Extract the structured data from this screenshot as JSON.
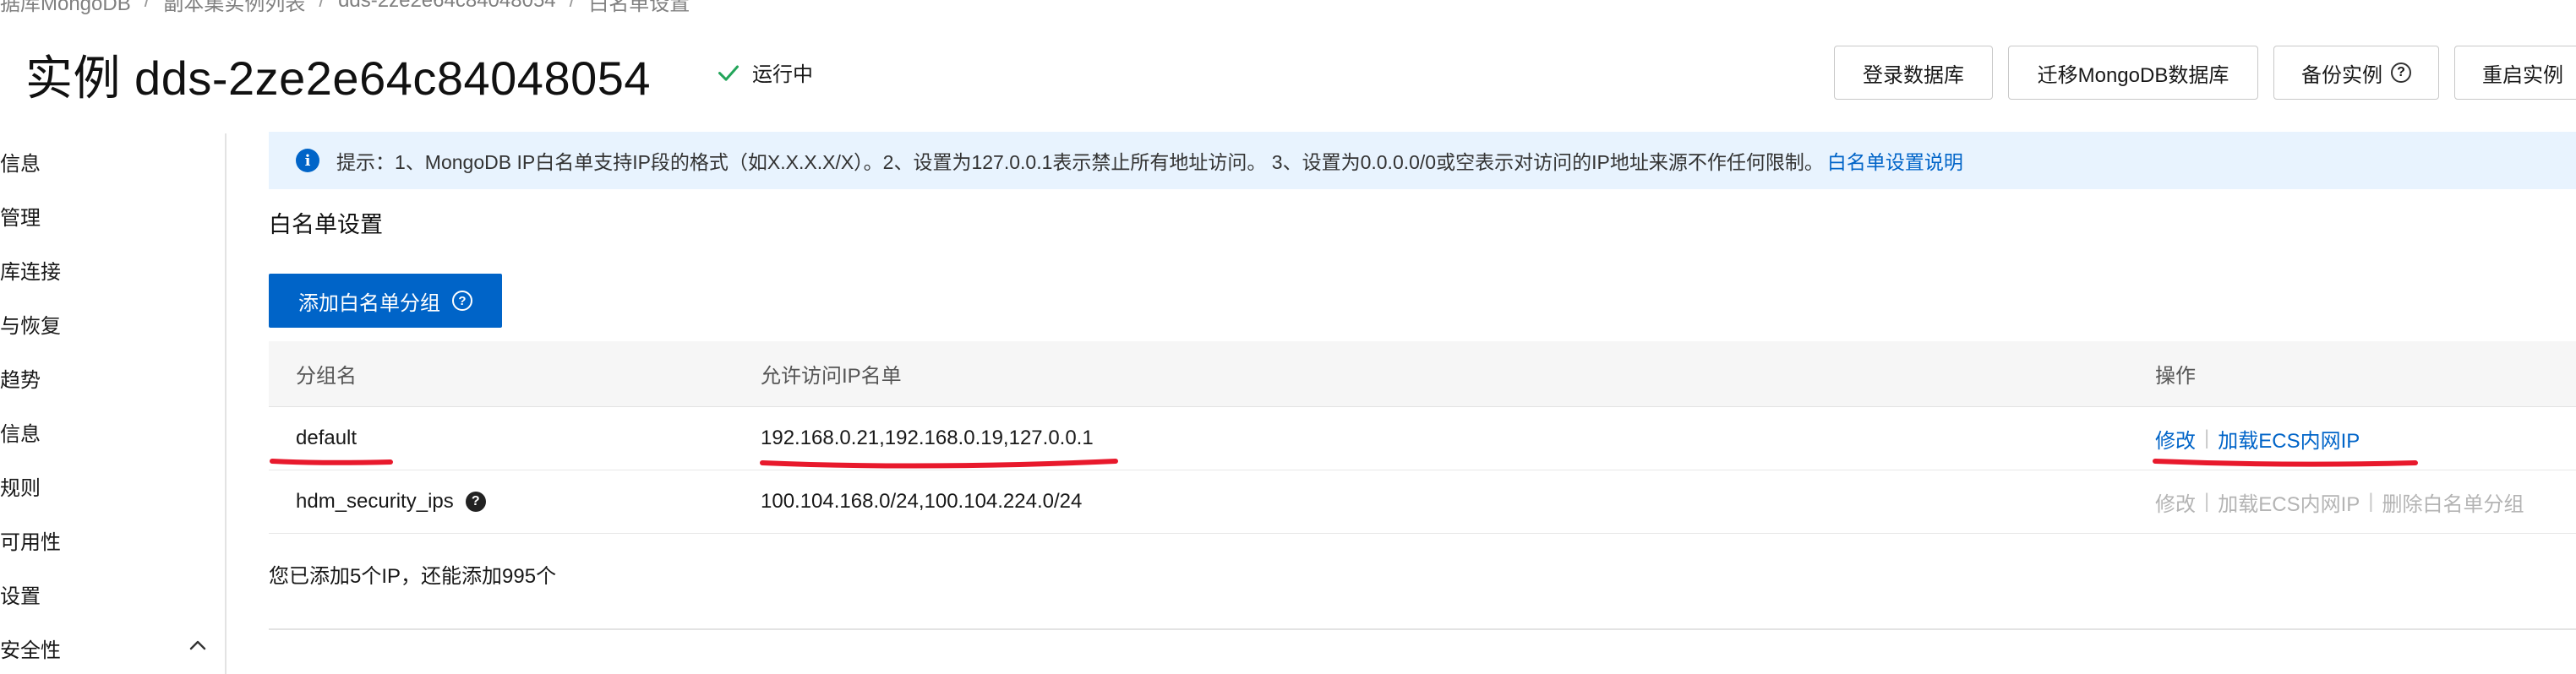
{
  "breadcrumb": {
    "items": [
      "据库MongoDB",
      "副本集实例列表",
      "dds-2ze2e64c84048054",
      "白名单设置"
    ],
    "separator": "/"
  },
  "header": {
    "title": "实例 dds-2ze2e64c84048054",
    "status": "运行中",
    "buttons": {
      "login_db": "登录数据库",
      "migrate": "迁移MongoDB数据库",
      "backup": "备份实例",
      "restart": "重启实例"
    }
  },
  "sidebar": {
    "items": [
      "信息",
      "管理",
      "库连接",
      "与恢复",
      "趋势",
      "信息",
      "规则",
      "可用性",
      "设置",
      "安全性"
    ]
  },
  "info_bar": {
    "text": "提示：1、MongoDB IP白名单支持IP段的格式（如X.X.X.X/X）。2、设置为127.0.0.1表示禁止所有地址访问。 3、设置为0.0.0.0/0或空表示对访问的IP地址来源不作任何限制。",
    "link": "白名单设置说明"
  },
  "section": {
    "title": "白名单设置",
    "add_button": "添加白名单分组"
  },
  "table": {
    "columns": [
      "分组名",
      "允许访问IP名单",
      "操作"
    ],
    "rows": [
      {
        "group": "default",
        "ips": "192.168.0.21,192.168.0.19,127.0.0.1",
        "actions": [
          "修改",
          "加载ECS内网IP"
        ]
      },
      {
        "group": "hdm_security_ips",
        "ips": "100.104.168.0/24,100.104.224.0/24",
        "actions": [
          "修改",
          "加载ECS内网IP",
          "删除白名单分组"
        ]
      }
    ]
  },
  "summary": "您已添加5个IP，还能添加995个",
  "colors": {
    "primary": "#0064c8",
    "info_bg": "#e8f3fe",
    "success": "#23a55a",
    "annotation": "#e8192c",
    "disabled": "#b4b4b4"
  }
}
